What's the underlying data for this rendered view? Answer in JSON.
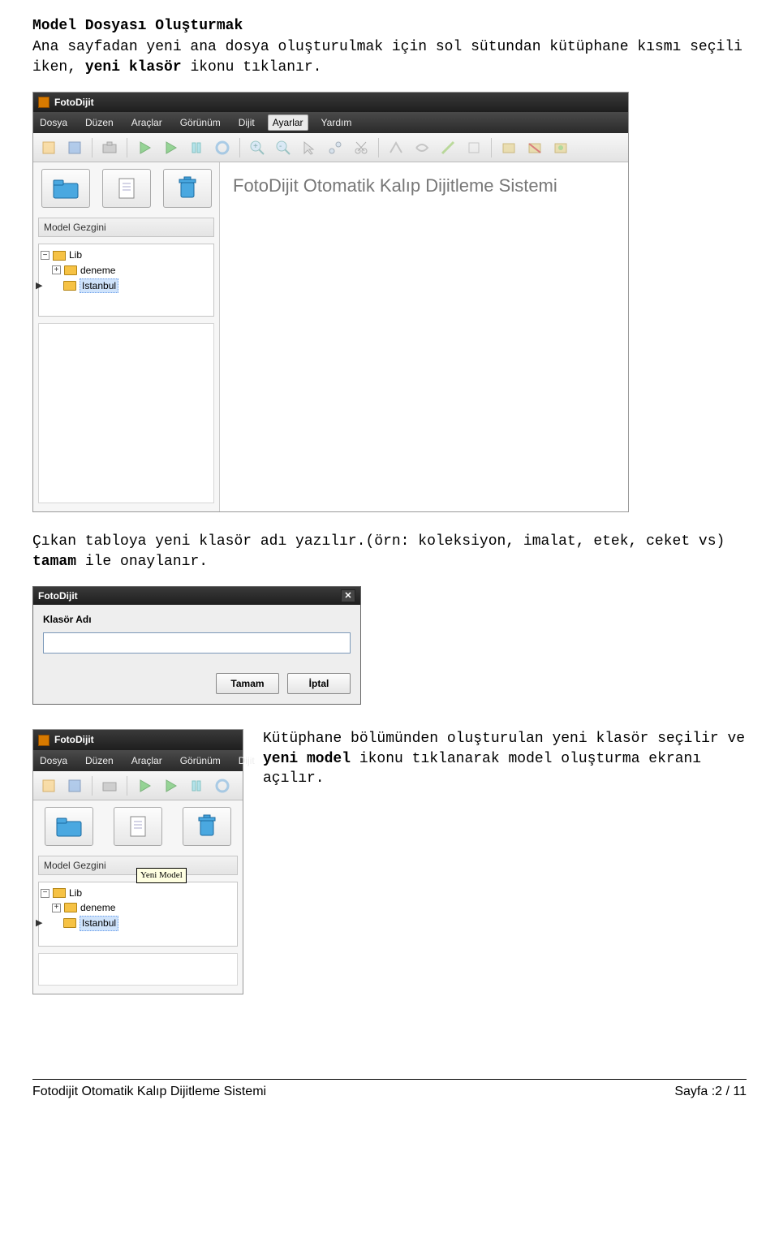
{
  "doc": {
    "heading": "Model Dosyası Oluşturmak",
    "para1_pre": "Ana sayfadan yeni ana dosya oluşturulmak için sol sütundan kütüphane kısmı seçili iken, ",
    "para1_bold": "yeni klasör",
    "para1_post": " ikonu tıklanır.",
    "para2_pre": "Çıkan tabloya yeni klasör adı yazılır.(örn: koleksiyon, imalat, etek, ceket vs) ",
    "para2_bold": "tamam",
    "para2_post": " ile onaylanır.",
    "para3_pre": "Kütüphane bölümünden oluşturulan yeni klasör seçilir ve ",
    "para3_bold": "yeni model",
    "para3_post": " ikonu tıklanarak model oluşturma ekranı açılır."
  },
  "app1": {
    "title": "FotoDijit",
    "menu": [
      "Dosya",
      "Düzen",
      "Araçlar",
      "Görünüm",
      "Dijit",
      "Ayarlar",
      "Yardım"
    ],
    "menu_active": "Ayarlar",
    "panel_label": "Model Gezgini",
    "tree": {
      "root": "Lib",
      "child1": "deneme",
      "child2": "Istanbul"
    },
    "banner": "FotoDijit Otomatik Kalıp Dijitleme Sistemi"
  },
  "dialog": {
    "title": "FotoDijit",
    "label": "Klasör Adı",
    "input_value": "",
    "ok": "Tamam",
    "cancel": "İptal"
  },
  "app2": {
    "title": "FotoDijit",
    "menu": [
      "Dosya",
      "Düzen",
      "Araçlar",
      "Görünüm",
      "Dijit"
    ],
    "panel_label": "Model Gezgini",
    "tree": {
      "root": "Lib",
      "child1": "deneme",
      "child2": "Istanbul"
    },
    "tooltip": "Yeni Model"
  },
  "footer": {
    "left": "Fotodijit Otomatik Kalıp Dijitleme Sistemi",
    "right": "Sayfa :2 / 11"
  },
  "icons": {
    "folder_blue": "folder-icon",
    "new_model": "new-model-icon",
    "trash": "trash-icon"
  }
}
